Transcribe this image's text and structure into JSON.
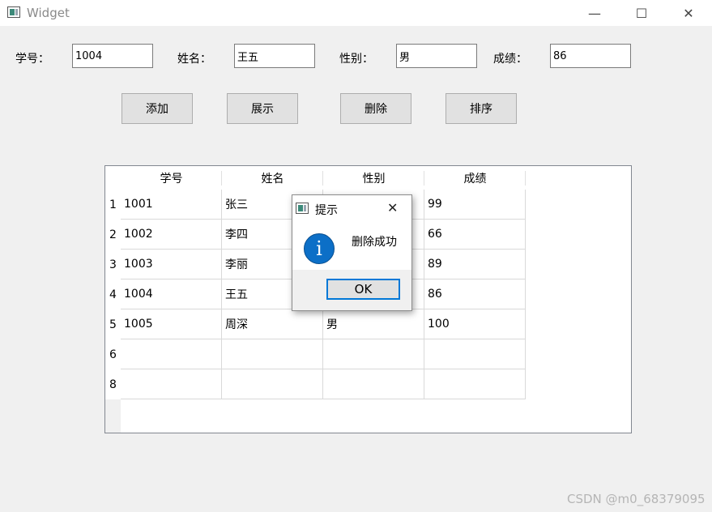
{
  "window": {
    "title": "Widget",
    "controls": {
      "minimize": "—",
      "maximize": "☐",
      "close": "✕"
    }
  },
  "form": {
    "id_label": "学号：",
    "id_value": "1004",
    "name_label": "姓名：",
    "name_value": "王五",
    "gender_label": "性别：",
    "gender_value": "男",
    "score_label": "成绩：",
    "score_value": "86"
  },
  "toolbar": {
    "add_label": "添加",
    "show_label": "展示",
    "delete_label": "删除",
    "sort_label": "排序"
  },
  "table": {
    "columns": [
      "学号",
      "姓名",
      "性别",
      "成绩"
    ],
    "rows": [
      {
        "header": "1",
        "cells": [
          "1001",
          "张三",
          "",
          "99"
        ]
      },
      {
        "header": "2",
        "cells": [
          "1002",
          "李四",
          "",
          "66"
        ]
      },
      {
        "header": "3",
        "cells": [
          "1003",
          "李丽",
          "",
          "89"
        ]
      },
      {
        "header": "4",
        "cells": [
          "1004",
          "王五",
          "",
          "86"
        ]
      },
      {
        "header": "5",
        "cells": [
          "1005",
          "周深",
          "男",
          "100"
        ]
      },
      {
        "header": "6",
        "cells": [
          "",
          "",
          "",
          ""
        ]
      },
      {
        "header": "8",
        "cells": [
          "",
          "",
          "",
          ""
        ]
      }
    ]
  },
  "dialog": {
    "title": "提示",
    "message": "删除成功",
    "ok_label": "OK",
    "close_glyph": "✕",
    "info_glyph": "i"
  },
  "watermark": "CSDN @m0_68379095"
}
